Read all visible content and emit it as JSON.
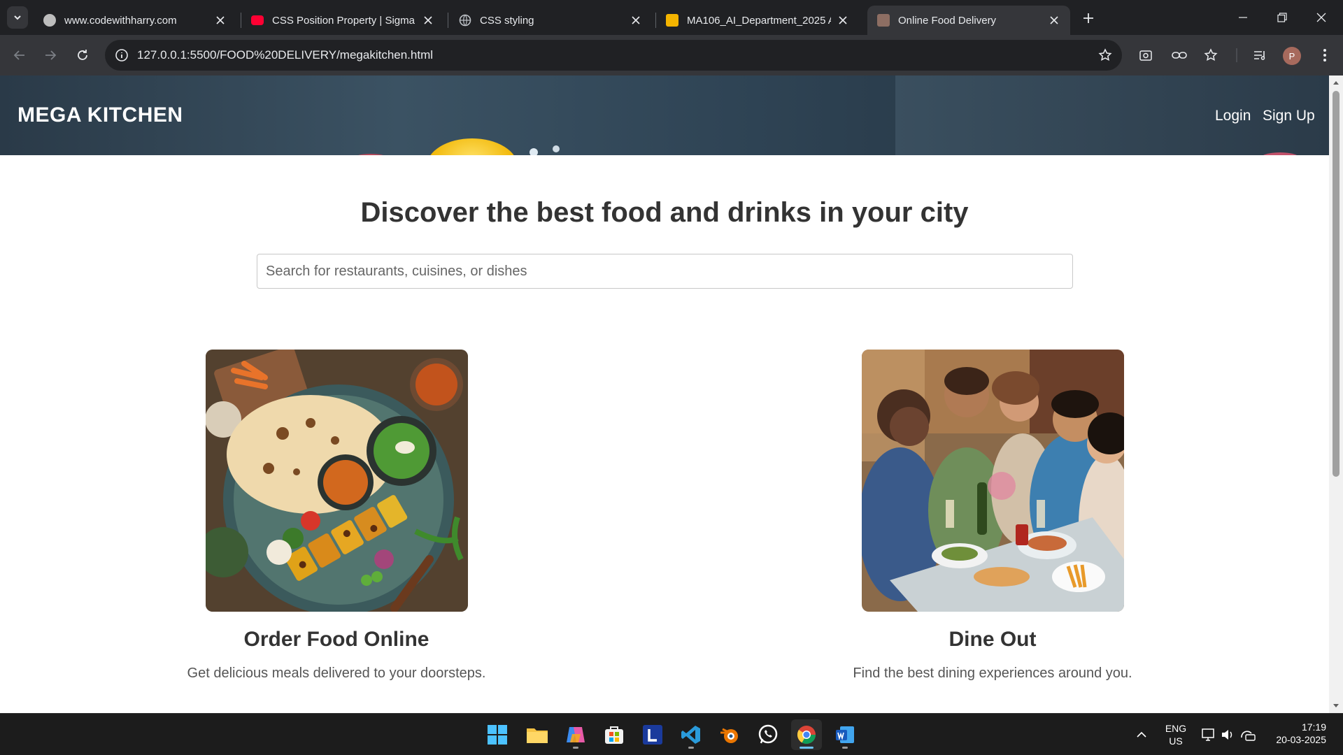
{
  "browser": {
    "tabs": [
      {
        "title": "www.codewithharry.com",
        "favicon": "globe-dark-icon"
      },
      {
        "title": "CSS Position Property | Sigma W",
        "favicon": "youtube-icon"
      },
      {
        "title": "CSS styling",
        "favicon": "globe-icon"
      },
      {
        "title": "MA106_AI_Department_2025 A",
        "favicon": "google-slides-icon"
      },
      {
        "title": "Online Food Delivery",
        "favicon": "site-icon",
        "active": true
      }
    ],
    "url": "127.0.0.1:5500/FOOD%20DELIVERY/megakitchen.html",
    "profile_initial": "P"
  },
  "header": {
    "brand": "MEGA KITCHEN",
    "links": [
      "Login",
      "Sign Up"
    ]
  },
  "main": {
    "headline": "Discover the best food and drinks in your city",
    "search": {
      "placeholder": "Search for restaurants, cuisines, or dishes",
      "value": ""
    }
  },
  "cards": [
    {
      "title": "Order Food Online",
      "description": "Get delicious meals delivered to your doorsteps.",
      "image": "indian-food-platter-image"
    },
    {
      "title": "Dine Out",
      "description": "Find the best dining experiences around you.",
      "image": "friends-dining-image"
    }
  ],
  "taskbar": {
    "apps": [
      "start-icon",
      "file-explorer-icon",
      "copilot-icon",
      "store-icon",
      "l-app-icon",
      "vscode-icon",
      "blender-icon",
      "whatsapp-icon",
      "chrome-icon",
      "word-icon"
    ],
    "language": "ENG",
    "region": "US",
    "time": "17:19",
    "date": "20-03-2025"
  },
  "colors": {
    "accent": "#6cc3f5",
    "hero": "#2f4455",
    "text": "#333333"
  }
}
